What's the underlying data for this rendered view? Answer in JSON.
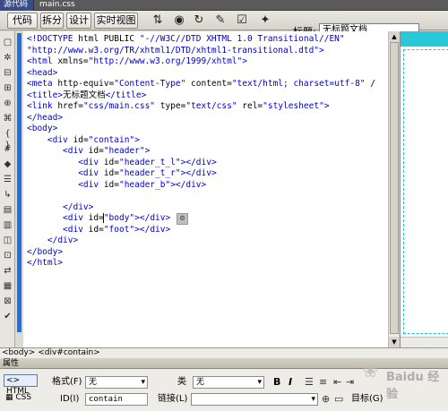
{
  "file_tabs": {
    "active": "源代码",
    "other": "main.css"
  },
  "toolbar": {
    "code_label": "代码",
    "split_label": "拆分",
    "design_label": "设计",
    "live_label": "实时视图",
    "icons": [
      "file-manage-icon",
      "preview-icon",
      "refresh-icon",
      "visual-aids-icon",
      "validate-icon",
      "check-browser-icon"
    ],
    "title_label": "标题:",
    "title_value": "无标题文档"
  },
  "gutter_icons": [
    "open-documents-icon",
    "show-code-nav-icon",
    "collapse-tag-icon",
    "collapse-selection-icon",
    "expand-all-icon",
    "select-parent-tag-icon",
    "balance-braces-icon",
    "line-numbers-icon",
    "highlight-invalid-icon",
    "syntax-coloring-icon",
    "auto-indent-icon",
    "apply-comment-icon",
    "remove-comment-icon",
    "wrap-tag-icon",
    "recent-snippets-icon",
    "move-css-icon",
    "indent-icon",
    "outdent-icon",
    "format-source-icon"
  ],
  "code_lines": [
    "<!DOCTYPE html PUBLIC \"-//W3C//DTD XHTML 1.0 Transitional//EN\"",
    "\"http://www.w3.org/TR/xhtml1/DTD/xhtml1-transitional.dtd\">",
    "<html xmlns=\"http://www.w3.org/1999/xhtml\">",
    "<head>",
    "<meta http-equiv=\"Content-Type\" content=\"text/html; charset=utf-8\" /",
    "<title>无标题文档</title>",
    "<link href=\"css/main.css\" type=\"text/css\" rel=\"stylesheet\">",
    "</head>",
    "<body>",
    "    <div id=\"contain\">",
    "       <div id=\"header\">",
    "          <div id=\"header_t_l\"></div>",
    "          <div id=\"header_t_r\"></div>",
    "          <div id=\"header_b\"></div>",
    "",
    "       </div>",
    "       <div id=\"body\"></div>",
    "       <div id=\"foot\"></div>",
    "    </div>",
    "</body>",
    "</html>"
  ],
  "status_bar": {
    "path": "<body> <div#contain>"
  },
  "properties": {
    "header": "属性",
    "html_button": "HTML",
    "css_button": "CSS",
    "format_label": "格式(F)",
    "format_value": "无",
    "class_label": "类",
    "class_value": "无",
    "id_label": "ID(I)",
    "id_value": "contain",
    "link_label": "链接(L)",
    "link_value": "",
    "bold": "B",
    "italic": "I",
    "target_label": "目标(G)"
  },
  "watermark": "Baidu 经验",
  "colors": {
    "accent_blue": "#1e6ee6",
    "design_cyan": "#29c8d8",
    "tag_blue": "#0000cc"
  }
}
